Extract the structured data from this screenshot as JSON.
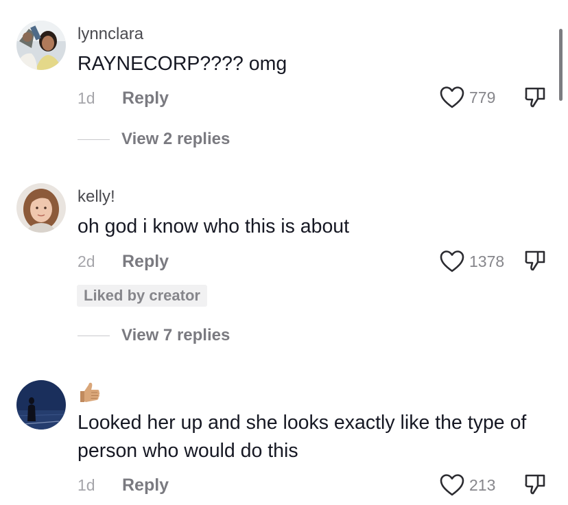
{
  "comments": [
    {
      "username": "lynnclara",
      "text": "RAYNECORP???? omg",
      "time": "1d",
      "reply_label": "Reply",
      "likes": "779",
      "view_replies": "View 2 replies"
    },
    {
      "username": "kelly!",
      "text": "oh god i know who this is about",
      "time": "2d",
      "reply_label": "Reply",
      "likes": "1378",
      "badge": "Liked by creator",
      "view_replies": "View 7 replies"
    },
    {
      "username_icon": "thumbs-up-emoji",
      "text": "Looked her up and she looks exactly like the type of person who would do this",
      "time": "1d",
      "reply_label": "Reply",
      "likes": "213"
    }
  ],
  "icons": {
    "like": "heart-outline-icon",
    "dislike": "thumbs-down-outline-icon"
  },
  "colors": {
    "text": "#161823",
    "secondary": "#86868b",
    "badge_bg": "#f1f1f2"
  }
}
